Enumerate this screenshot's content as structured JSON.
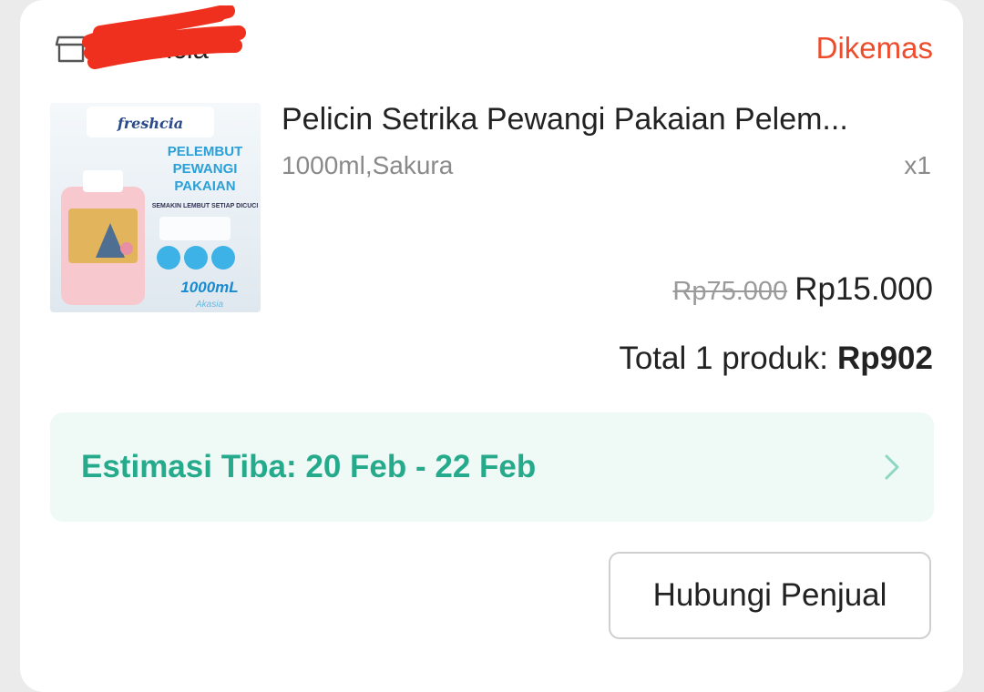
{
  "shop": {
    "name": "Freshcia",
    "status": "Dikemas"
  },
  "product": {
    "image_brand": "freshcia",
    "image_lines": [
      "PELEMBUT",
      "PEWANGI",
      "PAKAIAN"
    ],
    "image_tagline": "SEMAKIN LEMBUT SETIAP DICUCI",
    "image_volume": "1000mL",
    "image_variant": "Akasia",
    "title": "Pelicin Setrika Pewangi Pakaian Pelem...",
    "variant": "1000ml,Sakura",
    "quantity": "x1",
    "original_price": "Rp75.000",
    "price": "Rp15.000"
  },
  "summary": {
    "label": "Total 1 produk:",
    "amount": "Rp902"
  },
  "delivery": {
    "eta": "Estimasi Tiba: 20 Feb - 22 Feb"
  },
  "actions": {
    "contact_seller": "Hubungi Penjual"
  },
  "colors": {
    "status": "#ee4d2d",
    "eta_text": "#26aa8c",
    "eta_bg": "#effaf6"
  }
}
